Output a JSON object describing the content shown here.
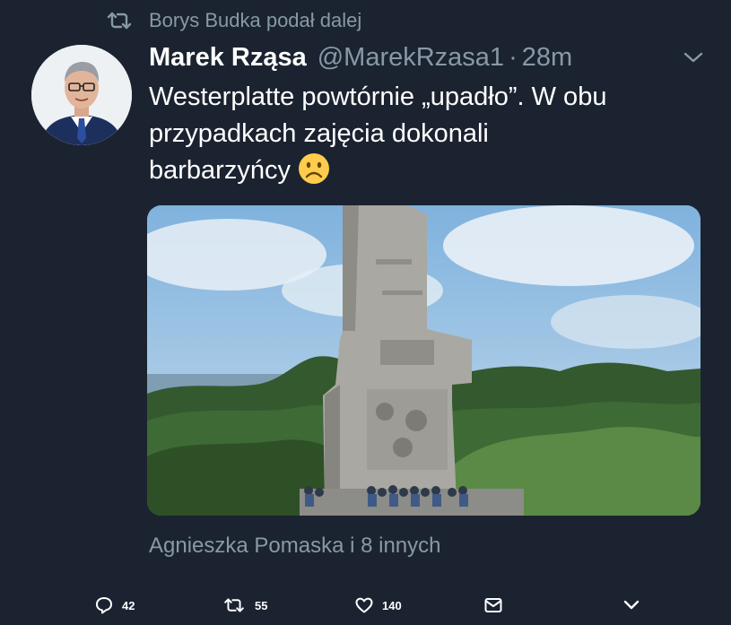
{
  "retweet_banner": {
    "text": "Borys Budka podał dalej",
    "icon": "retweet-icon"
  },
  "tweet": {
    "author_name": "Marek Rząsa",
    "author_handle": "@MarekRzasa1",
    "separator": "·",
    "timestamp": "28m",
    "text_lines": [
      "Westerplatte powtórnie „upadło”. W obu",
      "przypadkach zajęcia dokonali",
      "barbarzyńcy"
    ],
    "emoji": "frowning-face-emoji",
    "likers": "Agnieszka Pomaska i 8 innych"
  },
  "actions": {
    "reply_count": "42",
    "retweet_count": "55",
    "like_count": "140"
  },
  "colors": {
    "background": "#1b2330",
    "muted_text": "#8899a6",
    "text": "#ffffff"
  }
}
